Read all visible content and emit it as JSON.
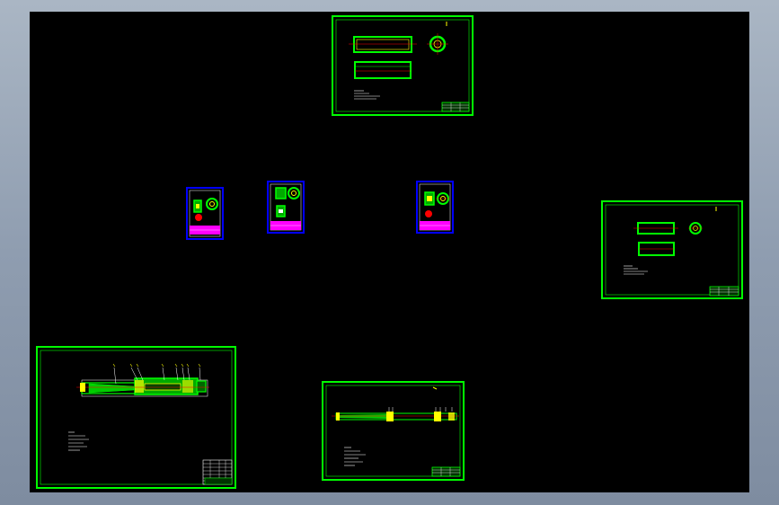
{
  "viewport": {
    "background": "#000000",
    "frame_color": "#00ff00",
    "accent_red": "#ff0000",
    "accent_yellow": "#ffff00",
    "accent_magenta": "#ff00ff",
    "accent_blue": "#0000ff"
  },
  "sheets": [
    {
      "name": "sheet-top-shaft-sleeve",
      "kind": "drawing"
    },
    {
      "name": "sheet-right-shaft-sleeve",
      "kind": "drawing"
    },
    {
      "name": "sheet-small-part-1",
      "kind": "drawing"
    },
    {
      "name": "sheet-small-part-2",
      "kind": "drawing"
    },
    {
      "name": "sheet-small-part-3",
      "kind": "drawing"
    },
    {
      "name": "sheet-assembly",
      "kind": "drawing"
    },
    {
      "name": "sheet-shaft",
      "kind": "drawing"
    }
  ]
}
